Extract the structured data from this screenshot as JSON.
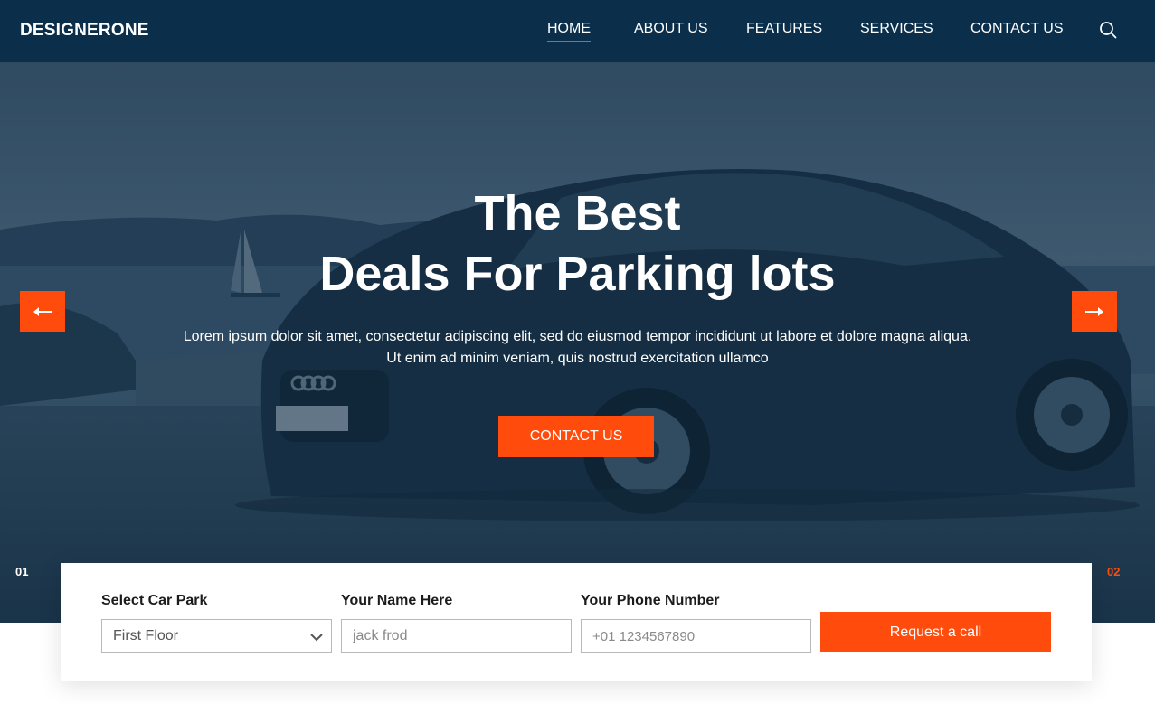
{
  "nav": {
    "brand": "DESIGNERONE",
    "items": [
      {
        "label": "HOME",
        "active": true
      },
      {
        "label": "ABOUT US",
        "active": false
      },
      {
        "label": "FEATURES",
        "active": false
      },
      {
        "label": "SERVICES",
        "active": false
      },
      {
        "label": "CONTACT US",
        "active": false
      }
    ],
    "search_icon": "search-icon"
  },
  "hero": {
    "title_line1": "The Best",
    "title_line2": "Deals For Parking lots",
    "text": "Lorem ipsum dolor sit amet, consectetur adipiscing elit, sed do eiusmod tempor incididunt ut labore et dolore magna aliqua. Ut enim ad minim veniam, quis nostrud exercitation ullamco",
    "cta_label": "CONTACT US",
    "prev_icon": "arrow-left-icon",
    "next_icon": "arrow-right-icon",
    "slide_current": "01",
    "slide_next": "02"
  },
  "booking": {
    "car_park_label": "Select Car Park",
    "car_park_value": "First Floor",
    "name_label": "Your Name Here",
    "name_placeholder": "jack frod",
    "phone_label": "Your Phone Number",
    "phone_placeholder": "+01 1234567890",
    "submit_label": "Request a call"
  },
  "colors": {
    "navbar": "#0b2e4b",
    "accent": "#ff4b0b",
    "overlay": "#0c2a42"
  }
}
